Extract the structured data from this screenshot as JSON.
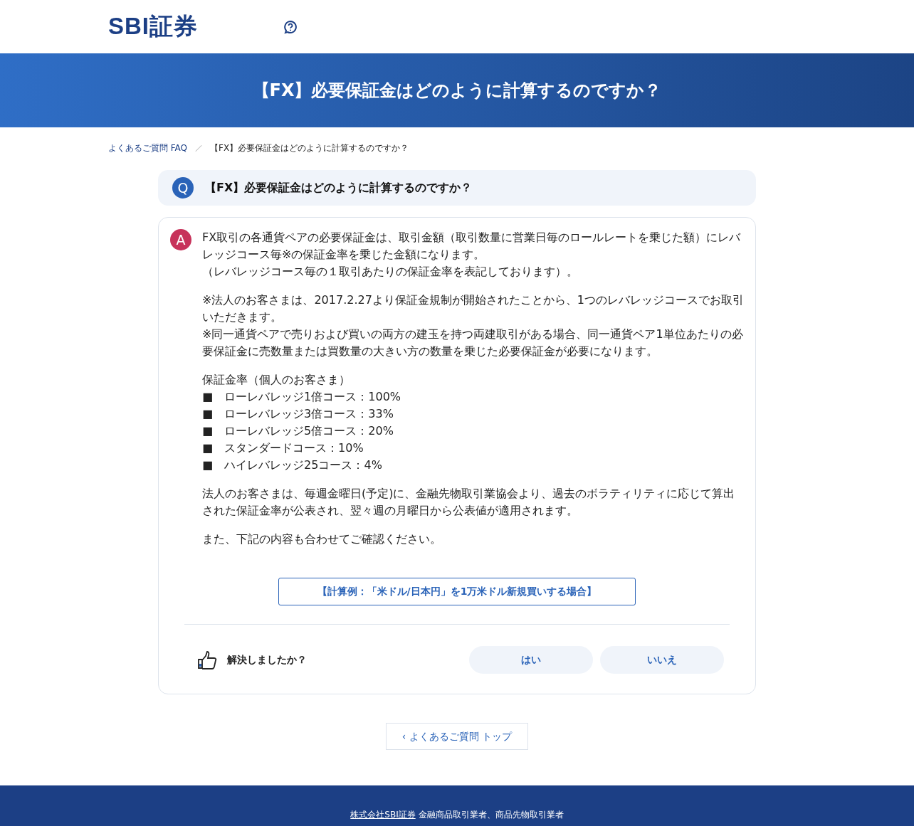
{
  "header": {
    "logo": "SBI証券"
  },
  "hero": {
    "title": "【FX】必要保証金はどのように計算するのですか？"
  },
  "breadcrumb": [
    {
      "label": "よくあるご質問 FAQ",
      "link": true
    },
    {
      "label": "【FX】必要保証金はどのように計算するのですか？",
      "link": false
    }
  ],
  "question": {
    "mark": "Q",
    "text": "【FX】必要保証金はどのように計算するのですか？"
  },
  "answer": {
    "mark": "A",
    "paragraphs": [
      [
        "FX取引の各通貨ペアの必要保証金は、取引金額（取引数量に営業日毎のロールレートを乗じた額）にレバレッジコース毎※の保証金率を乗じた金額になります。",
        "（レバレッジコース毎の１取引あたりの保証金率を表記しております）。"
      ],
      [
        "※法人のお客さまは、2017.2.27より保証金規制が開始されたことから、1つのレバレッジコースでお取引いただきます。",
        "※同一通貨ペアで売りおよび買いの両方の建玉を持つ両建取引がある場合、同一通貨ペア1単位あたりの必要保証金に売数量または買数量の大きい方の数量を乗じた必要保証金が必要になります。"
      ],
      [
        "保証金率（個人のお客さま）",
        "■　ローレバレッジ1倍コース：100%",
        "■　ローレバレッジ3倍コース：33%",
        "■　ローレバレッジ5倍コース：20%",
        "■　スタンダードコース：10%",
        "■　ハイレバレッジ25コース：4%"
      ],
      [
        "法人のお客さまは、毎週金曜日(予定)に、金融先物取引業協会より、過去のボラティリティに応じて算出された保証金率が公表され、翌々週の月曜日から公表値が適用されます。"
      ],
      [
        "また、下記の内容も合わせてご確認ください。"
      ]
    ],
    "link_button": "【計算例：「米ドル/日本円」を1万米ドル新規買いする場合】"
  },
  "feedback": {
    "prompt": "解決しましたか？",
    "buttons": [
      "はい",
      "いいえ"
    ]
  },
  "back_button": "‹ よくあるご質問 トップ",
  "footer": {
    "company_link": "株式会社SBI証券",
    "text": "金融商品取引業者、商品先物取引業者"
  }
}
